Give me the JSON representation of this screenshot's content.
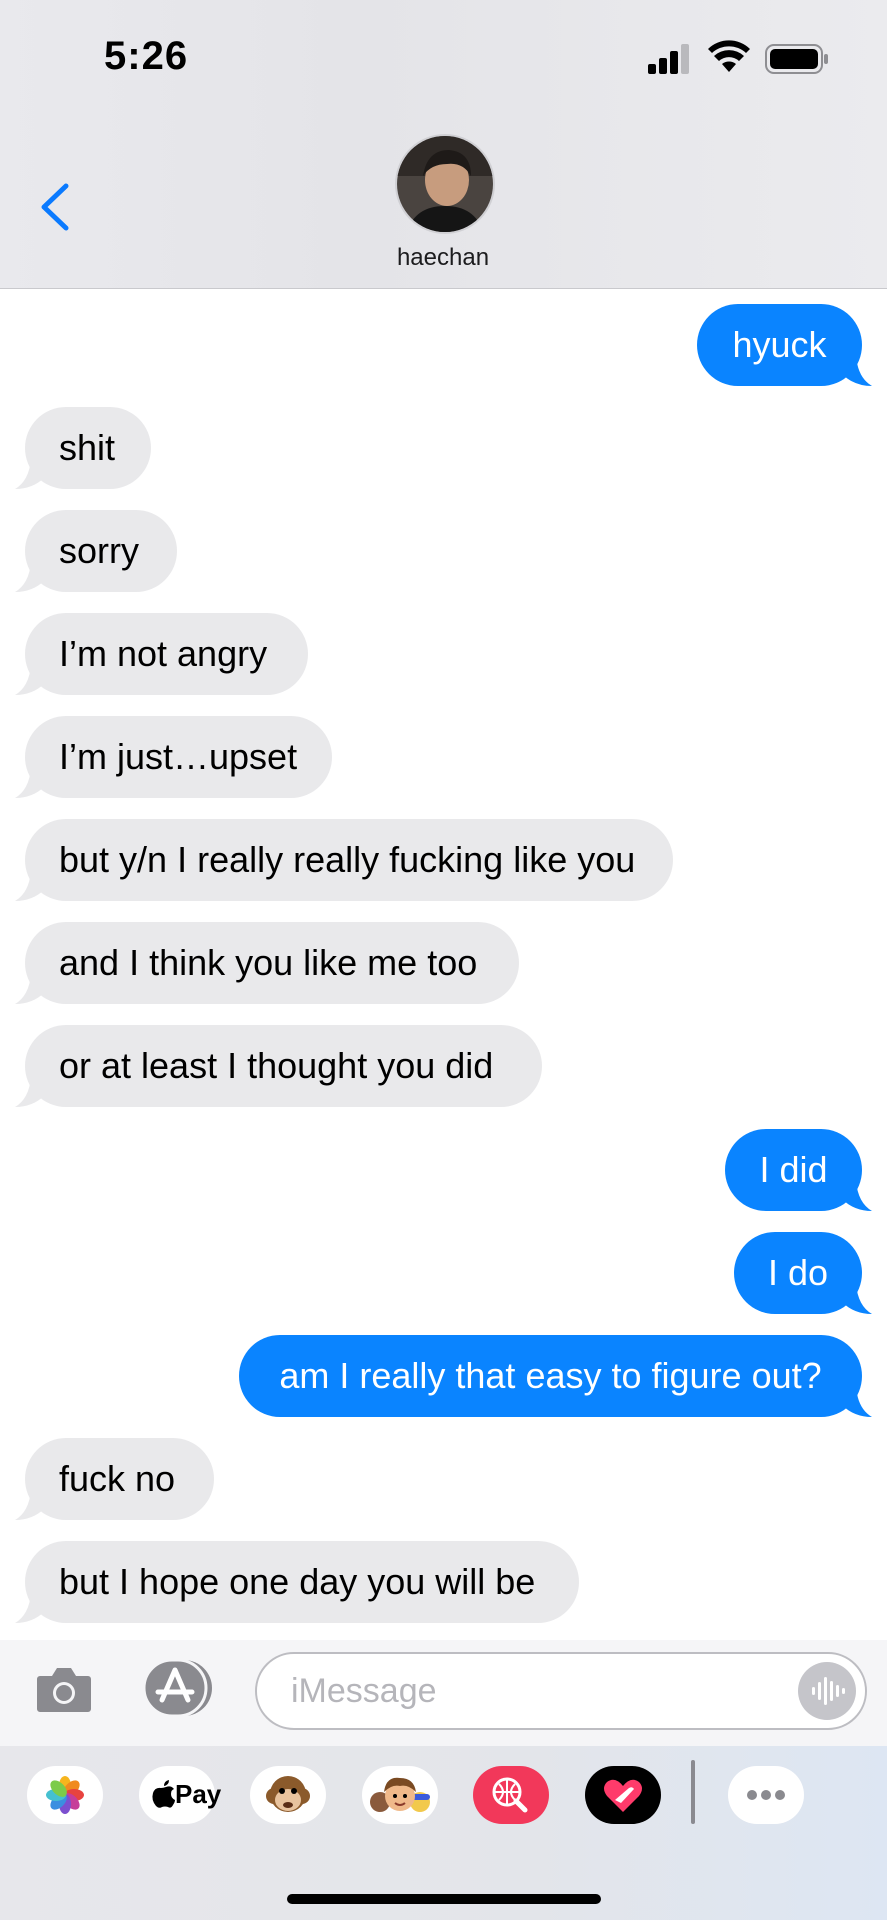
{
  "status_bar": {
    "time": "5:26"
  },
  "header": {
    "contact_name": "haechan"
  },
  "messages": [
    {
      "text": "hyuck",
      "sender": "me"
    },
    {
      "text": "shit",
      "sender": "them"
    },
    {
      "text": "sorry",
      "sender": "them"
    },
    {
      "text": "I’m not angry",
      "sender": "them"
    },
    {
      "text": "I’m just…upset",
      "sender": "them"
    },
    {
      "text": "but y/n I really really fucking like you",
      "sender": "them"
    },
    {
      "text": "and I think you like me too",
      "sender": "them"
    },
    {
      "text": "or at least I thought you did",
      "sender": "them"
    },
    {
      "text": "I did",
      "sender": "me"
    },
    {
      "text": "I do",
      "sender": "me"
    },
    {
      "text": "am I really that easy to figure out?",
      "sender": "me"
    },
    {
      "text": "fuck no",
      "sender": "them"
    },
    {
      "text": "but I hope one day you will be",
      "sender": "them"
    }
  ],
  "input": {
    "placeholder": "iMessage",
    "value": ""
  },
  "app_drawer": {
    "items": [
      {
        "name": "photos-icon"
      },
      {
        "name": "apple-pay-icon",
        "label": "Pay"
      },
      {
        "name": "animoji-icon"
      },
      {
        "name": "memoji-icon"
      },
      {
        "name": "image-search-icon"
      },
      {
        "name": "digital-touch-icon"
      },
      {
        "name": "more-icon"
      }
    ]
  },
  "colors": {
    "sent_bubble": "#0a84ff",
    "received_bubble": "#e9e9eb",
    "back_chevron": "#0a7aff"
  }
}
